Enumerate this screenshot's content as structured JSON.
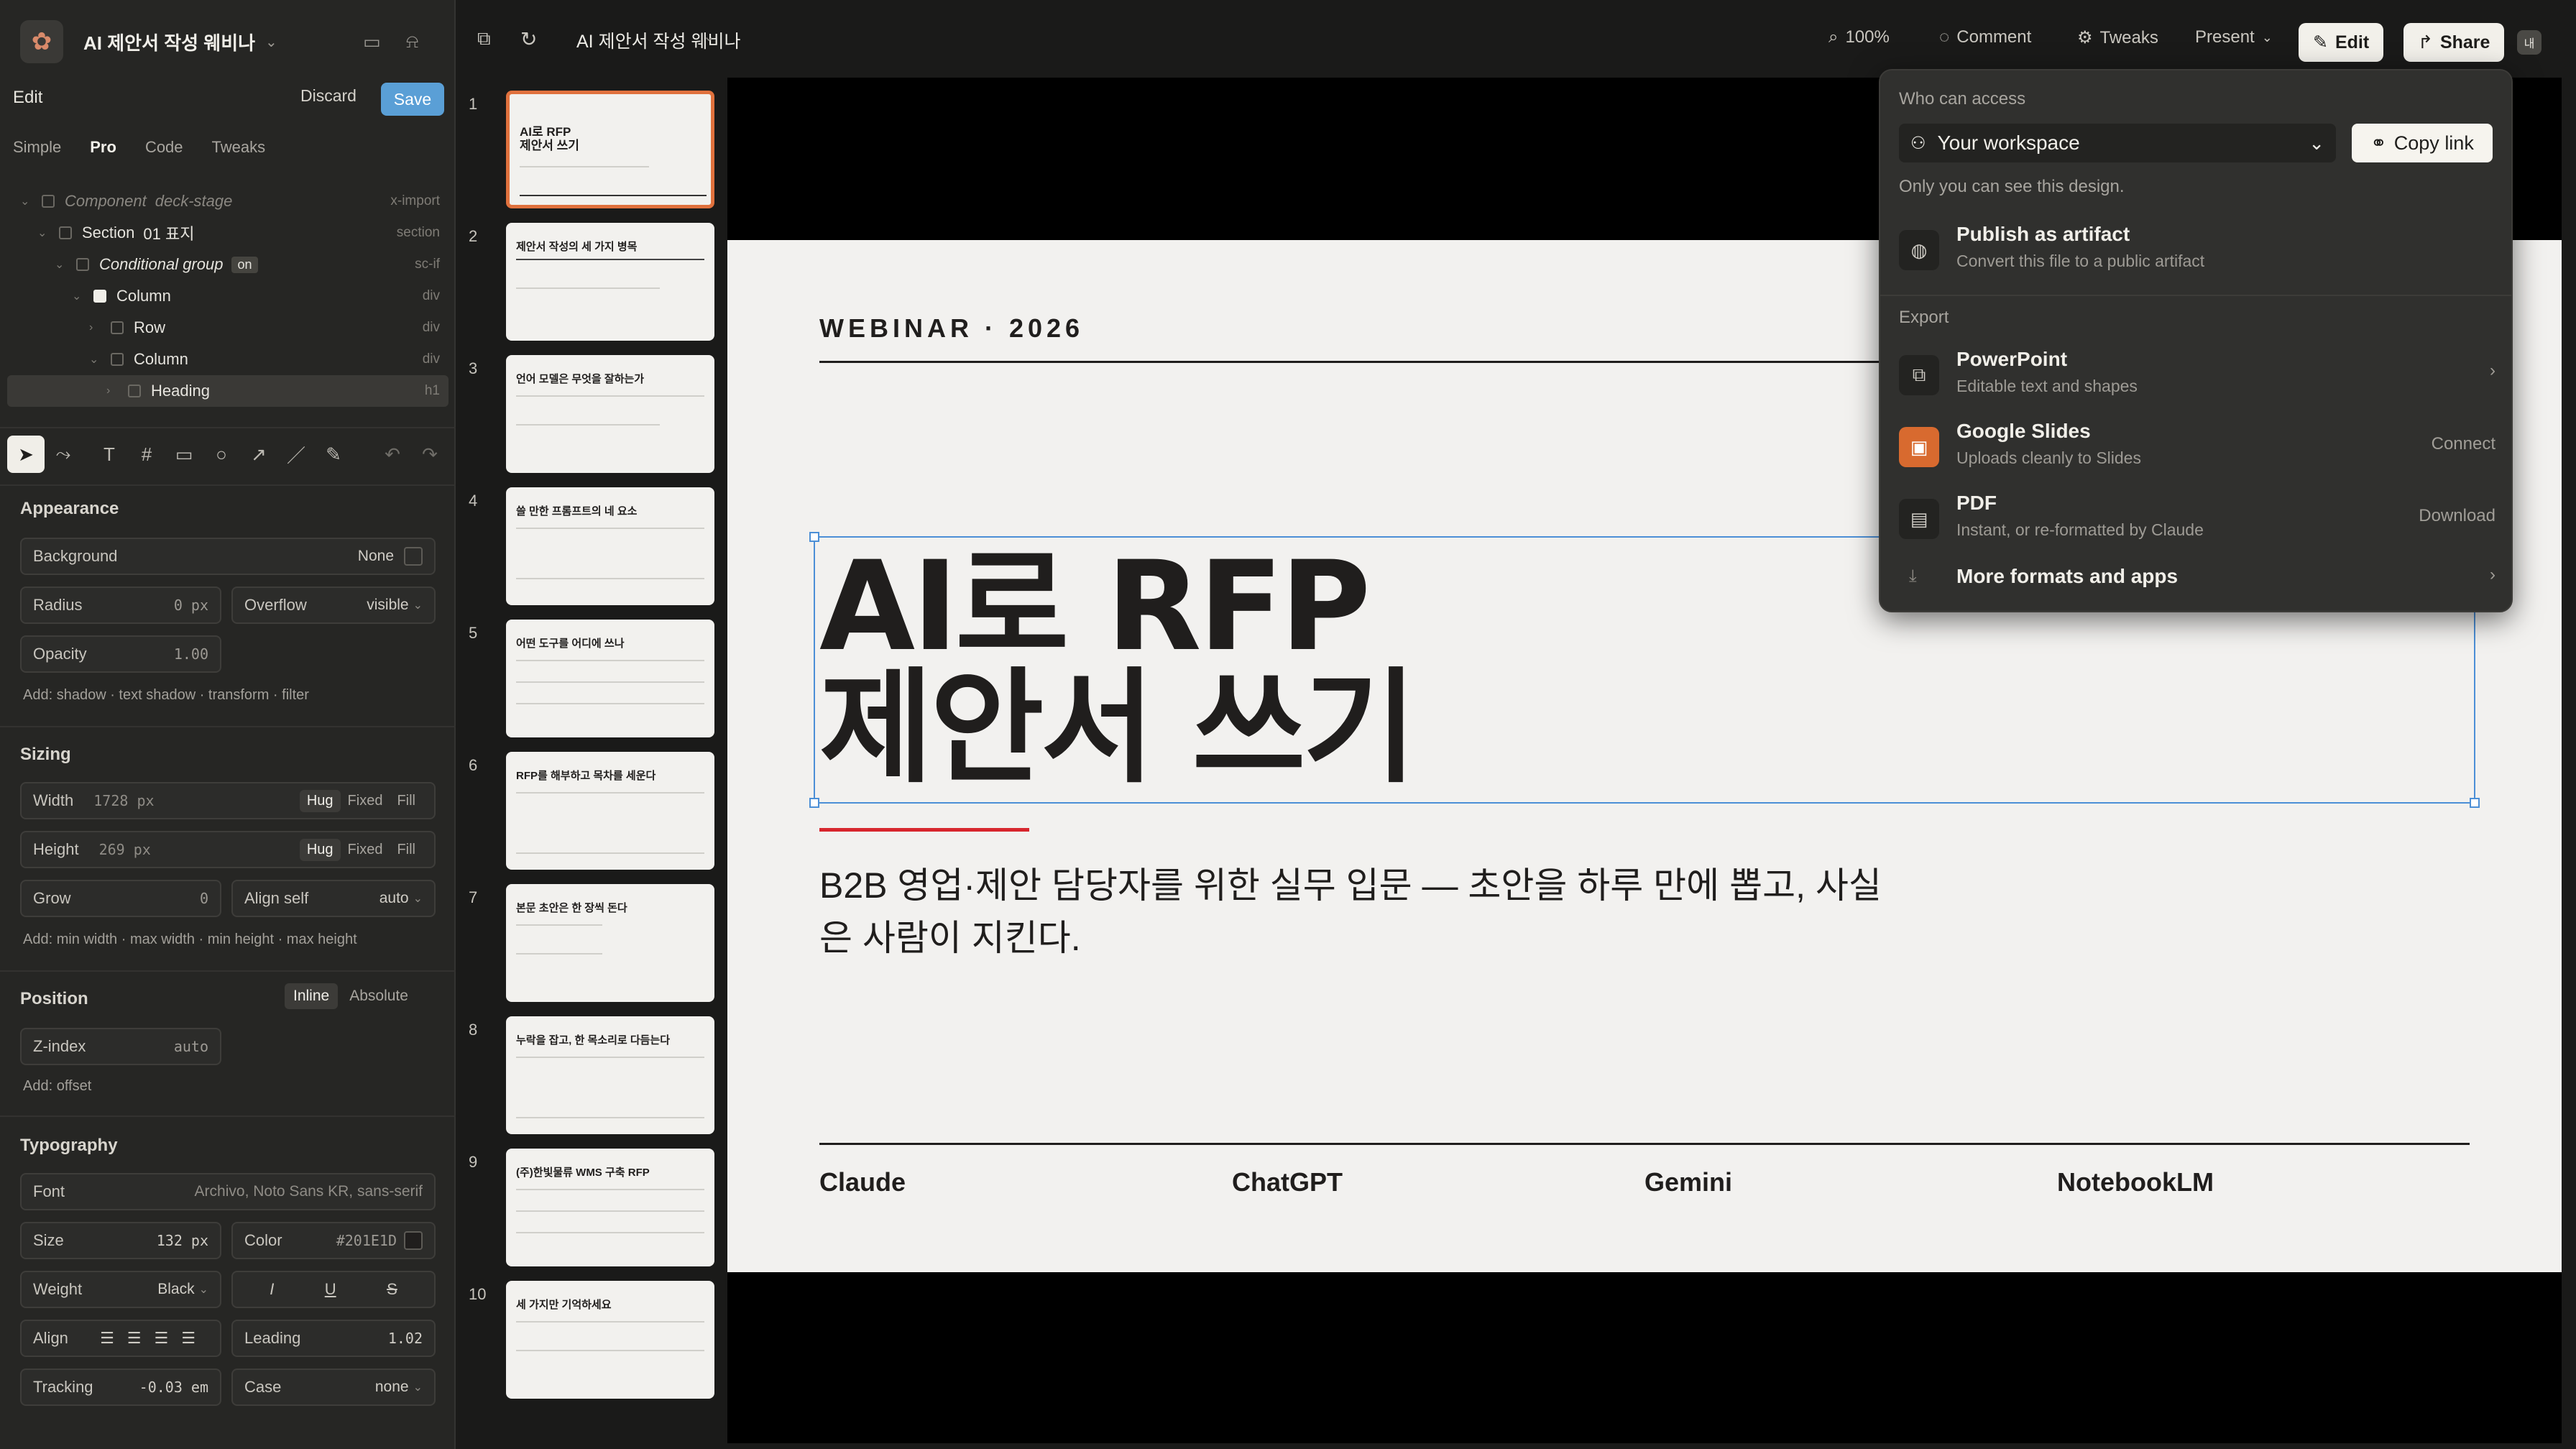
{
  "app": {
    "title": "AI 제안서 작성 웨비나"
  },
  "edit": {
    "label": "Edit",
    "discard": "Discard",
    "save": "Save"
  },
  "mode_tabs": [
    "Simple",
    "Pro",
    "Code",
    "Tweaks"
  ],
  "tree": [
    {
      "label": "Component",
      "extra": "deck-stage",
      "tag": "x-import"
    },
    {
      "label": "Section",
      "extra": "01 표지",
      "tag": "section"
    },
    {
      "label": "Conditional group",
      "extra": "on",
      "tag": "sc-if"
    },
    {
      "label": "Column",
      "extra": "",
      "tag": "div"
    },
    {
      "label": "Row",
      "extra": "",
      "tag": "div"
    },
    {
      "label": "Column",
      "extra": "",
      "tag": "div"
    },
    {
      "label": "Heading",
      "extra": "",
      "tag": "h1"
    }
  ],
  "appearance": {
    "title": "Appearance",
    "background_label": "Background",
    "background_value": "None",
    "radius_label": "Radius",
    "radius_value": "0 px",
    "overflow_label": "Overflow",
    "overflow_value": "visible",
    "opacity_label": "Opacity",
    "opacity_value": "1.00",
    "add_hint": "Add: shadow · text shadow · transform · filter"
  },
  "sizing": {
    "title": "Sizing",
    "width_label": "Width",
    "width_value": "1728 px",
    "height_label": "Height",
    "height_value": "269 px",
    "modes": [
      "Hug",
      "Fixed",
      "Fill"
    ],
    "grow_label": "Grow",
    "grow_value": "0",
    "align_self_label": "Align self",
    "align_self_value": "auto",
    "add_hint": "Add: min width · max width · min height · max height"
  },
  "position": {
    "title": "Position",
    "modes": [
      "Inline",
      "Absolute"
    ],
    "zindex_label": "Z-index",
    "zindex_value": "auto",
    "add_hint": "Add: offset"
  },
  "typography": {
    "title": "Typography",
    "font_label": "Font",
    "font_value": "Archivo, Noto Sans KR, sans-serif",
    "size_label": "Size",
    "size_value": "132 px",
    "color_label": "Color",
    "color_value": "#201E1D",
    "weight_label": "Weight",
    "weight_value": "Black",
    "align_label": "Align",
    "leading_label": "Leading",
    "leading_value": "1.02",
    "tracking_label": "Tracking",
    "tracking_value": "-0.03 em",
    "case_label": "Case",
    "case_value": "none",
    "styles": [
      "I",
      "U",
      "S"
    ]
  },
  "toolbar": {
    "project": "AI 제안서 작성 웨비나",
    "zoom": "100%",
    "comment": "Comment",
    "tweaks": "Tweaks",
    "present": "Present",
    "edit": "Edit",
    "share": "Share",
    "avatar": "내"
  },
  "thumbs": [
    {
      "n": "1",
      "title": "AI로 RFP\n제안서 쓰기"
    },
    {
      "n": "2",
      "title": "제안서 작성의 세 가지 병목"
    },
    {
      "n": "3",
      "title": "언어 모델은 무엇을 잘하는가"
    },
    {
      "n": "4",
      "title": "쓸 만한 프롬프트의 네 요소"
    },
    {
      "n": "5",
      "title": "어떤 도구를 어디에 쓰나"
    },
    {
      "n": "6",
      "title": "RFP를 해부하고 목차를 세운다"
    },
    {
      "n": "7",
      "title": "본문 초안은 한 장씩 돈다"
    },
    {
      "n": "8",
      "title": "누락을 잡고, 한 목소리로 다듬는다"
    },
    {
      "n": "9",
      "title": "(주)한빛물류 WMS 구축 RFP"
    },
    {
      "n": "10",
      "title": "세 가지만 기억하세요"
    }
  ],
  "slide": {
    "eyebrow": "WEBINAR · 2026",
    "heading_line1": "AI로 RFP",
    "heading_line2": "제안서 쓰기",
    "subtitle": "B2B 영업·제안 담당자를 위한 실무 입문 — 초안을 하루 만에 뽑고, 사실은 사람이 지킨다.",
    "brands": [
      "Claude",
      "ChatGPT",
      "Gemini",
      "NotebookLM"
    ]
  },
  "share": {
    "who_label": "Who can access",
    "access_value": "Your workspace",
    "copy_link": "Copy link",
    "access_note": "Only you can see this design.",
    "publish_title": "Publish as artifact",
    "publish_sub": "Convert this file to a public artifact",
    "export_label": "Export",
    "ppt_title": "PowerPoint",
    "ppt_sub": "Editable text and shapes",
    "gs_title": "Google Slides",
    "gs_sub": "Uploads cleanly to Slides",
    "gs_action": "Connect",
    "pdf_title": "PDF",
    "pdf_sub": "Instant, or re-formatted by Claude",
    "pdf_action": "Download",
    "more": "More formats and apps"
  }
}
